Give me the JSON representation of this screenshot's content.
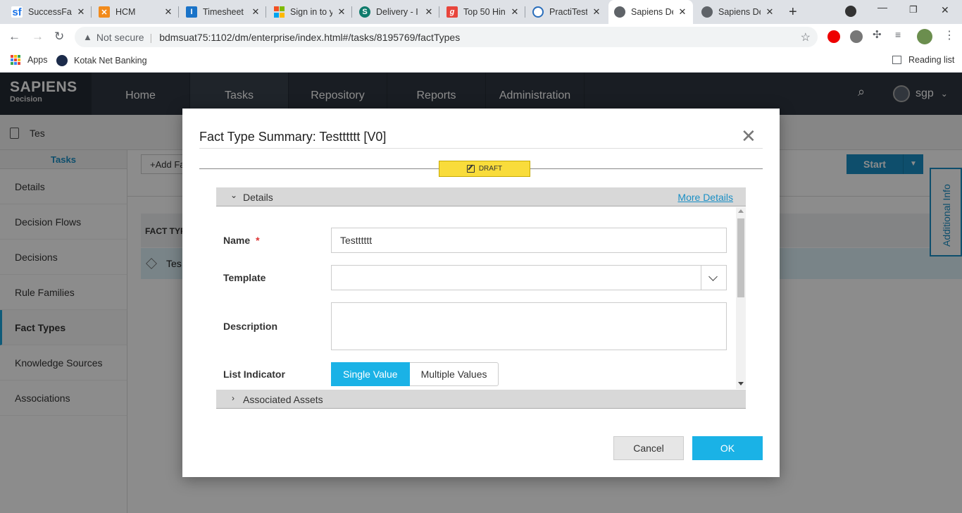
{
  "browser": {
    "tabs": [
      {
        "title": "SuccessFac",
        "fav": "sf",
        "color": "#1a73e8"
      },
      {
        "title": "HCM",
        "fav": "HCM-icon",
        "color": "#f28b1c"
      },
      {
        "title": "Timesheet",
        "fav": "I",
        "color": "#1a73c8"
      },
      {
        "title": "Sign in to y",
        "fav": "ms",
        "color": "#f25022"
      },
      {
        "title": "Delivery - I",
        "fav": "S",
        "color": "#0f7b6c"
      },
      {
        "title": "Top 50 Hin",
        "fav": "g",
        "color": "#e8453c"
      },
      {
        "title": "PractiTest -",
        "fav": "pt",
        "color": "#2a6ebb"
      },
      {
        "title": "Sapiens De",
        "fav": "globe",
        "color": "#5f6368"
      },
      {
        "title": "Sapiens De",
        "fav": "globe",
        "color": "#5f6368"
      }
    ],
    "not_secure": "Not secure",
    "url": "bdmsuat75:1102/dm/enterprise/index.html#/tasks/8195769/factTypes",
    "bookmarks": {
      "apps": "Apps",
      "kotak": "Kotak Net Banking",
      "reading_list": "Reading list"
    }
  },
  "app": {
    "logo_top": "SAPIENS",
    "logo_bottom": "Decision",
    "nav": [
      "Home",
      "Tasks",
      "Repository",
      "Reports",
      "Administration"
    ],
    "user": "sgp",
    "task_name": "Tes",
    "sidebar": {
      "header": "Tasks",
      "items": [
        "Details",
        "Decision Flows",
        "Decisions",
        "Rule Families",
        "Fact Types",
        "Knowledge Sources",
        "Associations"
      ]
    },
    "add_fact_button": "+Add Fa",
    "start_button": "Start",
    "grid_header": "FACT TYP",
    "grid_row": "Tes",
    "additional_info": "Additional Info"
  },
  "modal": {
    "title": "Fact Type Summary: Testttttt [V0]",
    "status_badge": "DRAFT",
    "details_section": "Details",
    "more_details_link": "More Details",
    "fields": {
      "name_label": "Name",
      "name_required": "*",
      "name_value": "Testttttt",
      "template_label": "Template",
      "template_value": "",
      "description_label": "Description",
      "description_value": "",
      "list_indicator_label": "List Indicator",
      "list_options": [
        "Single Value",
        "Multiple Values"
      ],
      "list_selected": "Single Value"
    },
    "associated_assets_section": "Associated Assets",
    "cancel_button": "Cancel",
    "ok_button": "OK"
  },
  "colors": {
    "accent": "#1ab2e6",
    "header_bg": "#2f3640",
    "draft_badge": "#f9dc3b"
  }
}
